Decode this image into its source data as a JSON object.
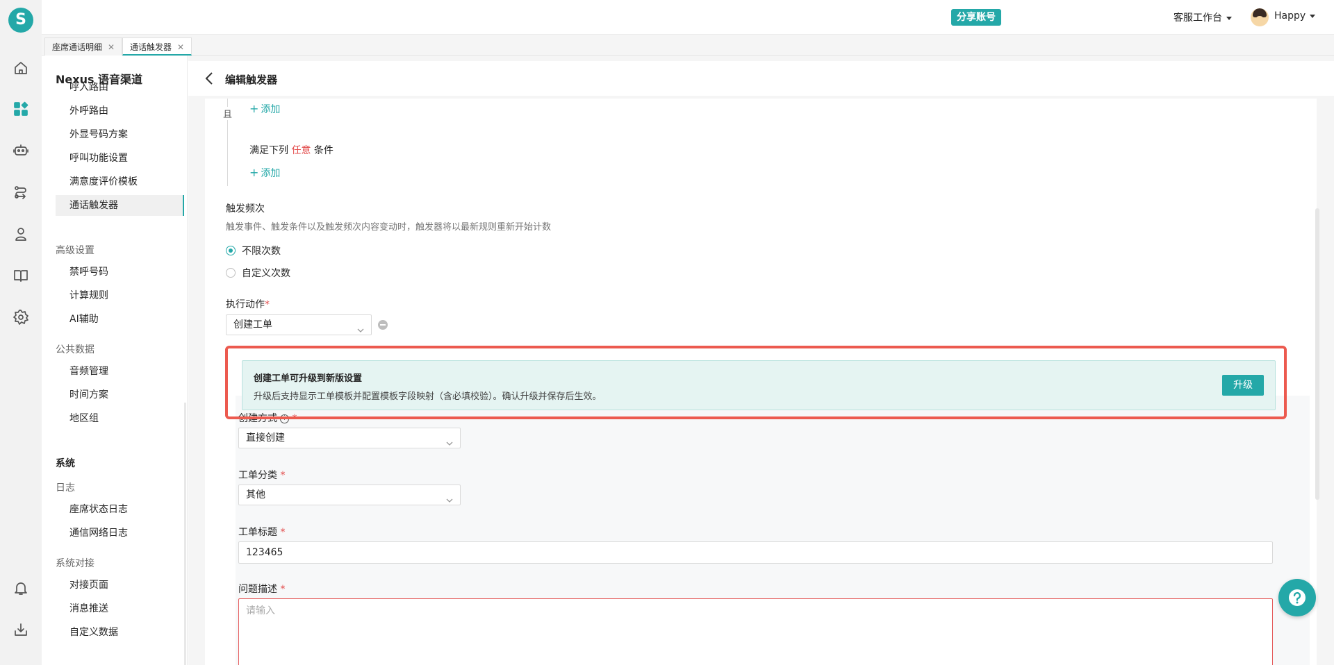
{
  "app": {
    "logo_letter": "S"
  },
  "rail_icons": [
    "home-icon",
    "apps-icon",
    "robot-icon",
    "route-icon",
    "user-icon",
    "book-icon",
    "gear-icon",
    "bell-icon",
    "download-icon"
  ],
  "topbar": {
    "share_label": "分享账号",
    "workspace_label": "客服工作台",
    "username": "Happy"
  },
  "tabs": [
    {
      "label": "座席通话明细"
    },
    {
      "label": "通话触发器"
    }
  ],
  "nav": {
    "title": "Nexus 语音渠道",
    "items_main": [
      "呼入路由",
      "外呼路由",
      "外显号码方案",
      "呼叫功能设置",
      "满意度评价模板",
      "通话触发器"
    ],
    "group_advanced": "高级设置",
    "items_advanced": [
      "禁呼号码",
      "计算规则",
      "AI辅助"
    ],
    "group_public": "公共数据",
    "items_public": [
      "音频管理",
      "时间方案",
      "地区组"
    ],
    "section_system": "系统",
    "group_log": "日志",
    "items_log": [
      "座席状态日志",
      "通信网络日志"
    ],
    "group_integration": "系统对接",
    "items_integration": [
      "对接页面",
      "消息推送",
      "自定义数据"
    ]
  },
  "page": {
    "title": "编辑触发器",
    "and_label": "且",
    "add_label": "添加",
    "any_cond_prefix": "满足下列",
    "any_cond_highlight": "任意",
    "any_cond_suffix": "条件",
    "freq_label": "触发频次",
    "freq_hint": "触发事件、触发条件以及触发频次内容变动时，触发器将以最新规则重新开始计数",
    "freq_options": [
      "不限次数",
      "自定义次数"
    ],
    "action_label": "执行动作",
    "required_mark": "*",
    "action_value": "创建工单",
    "notice_title": "创建工单可升级到新版设置",
    "notice_desc": "升级后支持显示工单模板并配置模板字段映射（含必填校验）。确认升级并保存后生效。",
    "upgrade_label": "升级",
    "create_mode_label": "创建方式",
    "create_mode_value": "直接创建",
    "category_label": "工单分类",
    "category_value": "其他",
    "ticket_title_label": "工单标题",
    "ticket_title_value": "123465",
    "desc_label": "问题描述",
    "desc_placeholder": "请输入"
  },
  "colors": {
    "accent": "#24a8a8",
    "danger": "#e34d4d",
    "highlight_border": "#ec5a4f"
  }
}
